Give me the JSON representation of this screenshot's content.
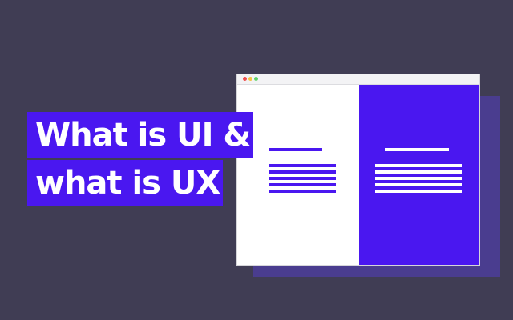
{
  "headline": {
    "line1": "What is UI &",
    "line2": "what is UX"
  },
  "illustration": {
    "window_controls": [
      "close",
      "minimize",
      "maximize"
    ],
    "left_pane_color": "#ffffff",
    "right_pane_color": "#4a17f0"
  },
  "colors": {
    "background": "#403d54",
    "accent": "#4a17f0",
    "shadow": "#4a3d8f",
    "text": "#ffffff"
  }
}
